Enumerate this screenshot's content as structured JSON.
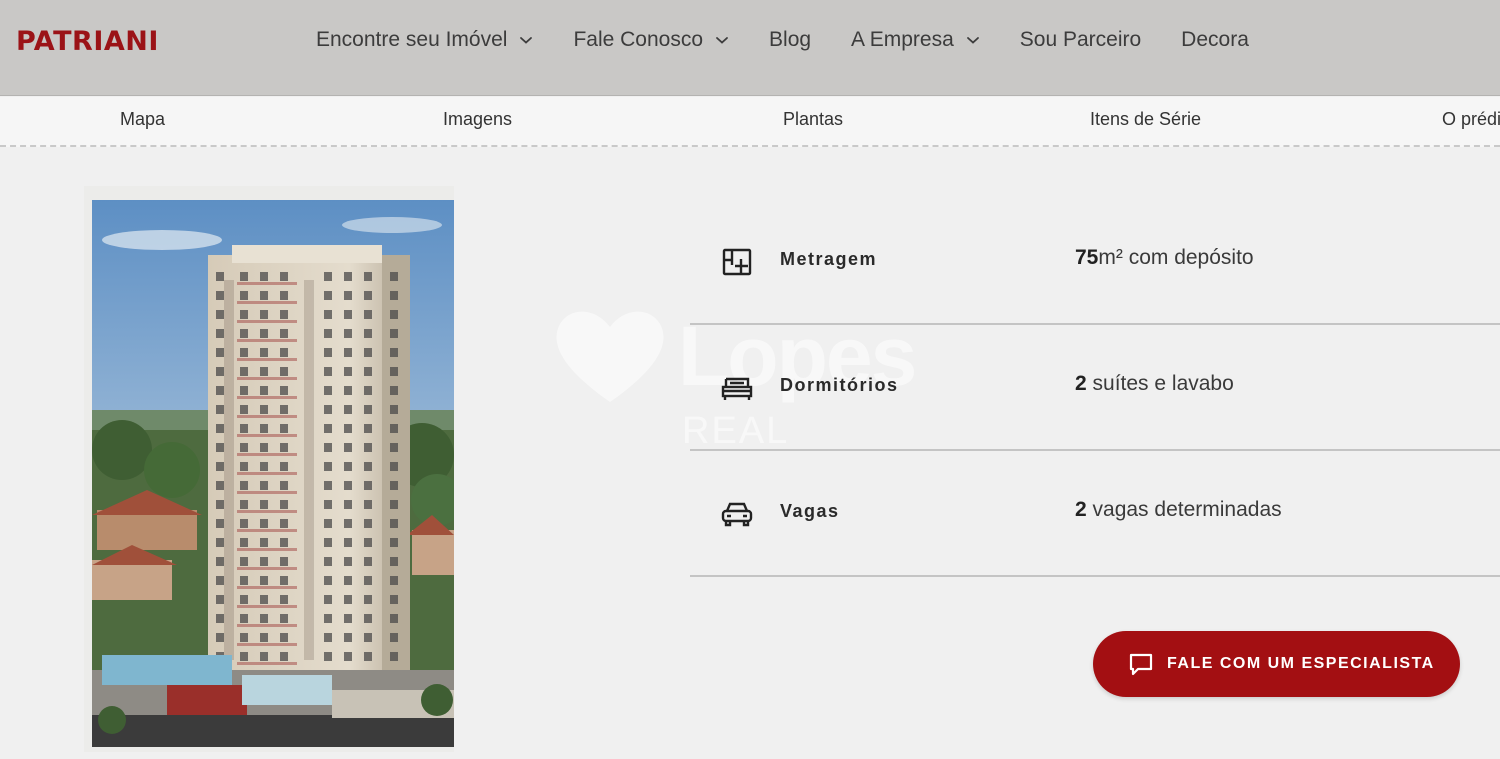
{
  "brand": {
    "logo_text": "PATRIANI",
    "accent_color": "#a30f12"
  },
  "header": {
    "nav": [
      {
        "label": "Encontre seu Imóvel",
        "has_dropdown": true
      },
      {
        "label": "Fale Conosco",
        "has_dropdown": true
      },
      {
        "label": "Blog",
        "has_dropdown": false
      },
      {
        "label": "A Empresa",
        "has_dropdown": true
      },
      {
        "label": "Sou Parceiro",
        "has_dropdown": false
      },
      {
        "label": "Decora",
        "has_dropdown": false
      }
    ]
  },
  "subnav": {
    "items": [
      {
        "label": "Mapa"
      },
      {
        "label": "Imagens"
      },
      {
        "label": "Plantas"
      },
      {
        "label": "Itens de Série"
      },
      {
        "label": "O prédio"
      }
    ]
  },
  "watermark": {
    "brand": "Lopes",
    "sub": "REAL"
  },
  "features": [
    {
      "icon": "floor-plan-icon",
      "label": "Metragem",
      "value_strong": "75",
      "value_unit": "m²",
      "value_rest": " com depósito"
    },
    {
      "icon": "bed-icon",
      "label": "Dormitórios",
      "value_strong": "2",
      "value_unit": "",
      "value_rest": " suítes e lavabo"
    },
    {
      "icon": "car-icon",
      "label": "Vagas",
      "value_strong": "2",
      "value_unit": "",
      "value_rest": " vagas determinadas"
    }
  ],
  "cta": {
    "label": "FALE COM UM ESPECIALISTA",
    "icon": "chat-icon"
  }
}
